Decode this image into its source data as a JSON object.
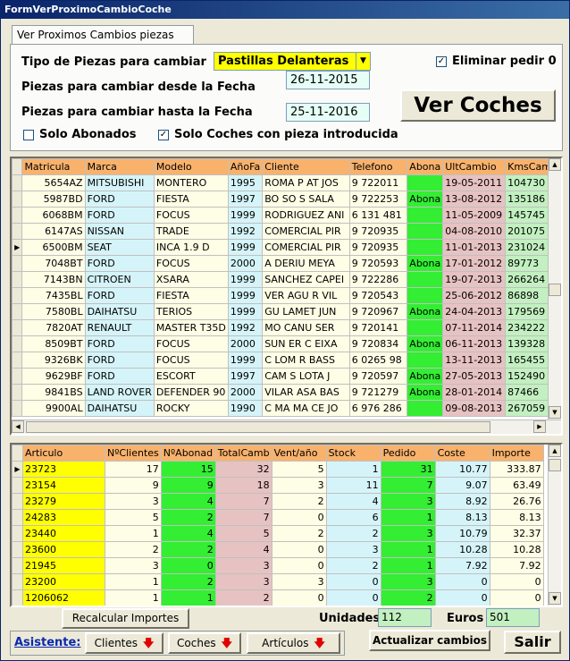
{
  "window": {
    "title": "FormVerProximoCambioCoche"
  },
  "tab": {
    "label": "Ver Proximos Cambios piezas"
  },
  "filters": {
    "tipo_label": "Tipo de Piezas para cambiar",
    "tipo_value": "Pastillas Delanteras",
    "desde_label": "Piezas para cambiar desde la Fecha",
    "desde_value": "26-11-2015",
    "hasta_label": "Piezas para cambiar hasta la Fecha",
    "hasta_value": "25-11-2016",
    "solo_abonados_label": "Solo Abonados",
    "solo_abonados_checked": false,
    "solo_coches_label": "Solo Coches con pieza introducida",
    "solo_coches_checked": true,
    "eliminar_label": "Eliminar pedir 0",
    "eliminar_checked": true,
    "ver_coches_label": "Ver Coches"
  },
  "cars": {
    "columns": [
      "Matricula",
      "Marca",
      "Modelo",
      "AñoFa",
      "Cliente",
      "Telefono",
      "Abona",
      "UltCambio",
      "KmsCamb"
    ],
    "current_row": 4,
    "rows": [
      [
        "5654AZ",
        "MITSUBISHI",
        "MONTERO",
        "1995",
        "ROMA P  AT JOS",
        "9   722011",
        "",
        "19-05-2011",
        "104730"
      ],
      [
        "5987BD",
        "FORD",
        "FIESTA",
        "1997",
        "BO  SO  S SALA",
        "9   722253",
        "Abona",
        "13-08-2012",
        "135186"
      ],
      [
        "6068BM",
        "FORD",
        "FOCUS",
        "1999",
        "RODRIGUEZ ANI",
        "6  131  481",
        "",
        "11-05-2009",
        "145745"
      ],
      [
        "6147AS",
        "NISSAN",
        "TRADE",
        "1992",
        "COMERCIAL PIR",
        "9   720935",
        "",
        "04-08-2010",
        "201075"
      ],
      [
        "6500BM",
        "SEAT",
        "INCA 1.9 D",
        "1999",
        "COMERCIAL PIR",
        "9   720935",
        "",
        "11-01-2013",
        "231024"
      ],
      [
        "7048BT",
        "FORD",
        "FOCUS",
        "2000",
        "A  DERIU MEYA",
        "9   720593",
        "Abona",
        "17-01-2012",
        "89773"
      ],
      [
        "7143BN",
        "CITROEN",
        "XSARA",
        "1999",
        "SANCHEZ CAPEI",
        "9   722286",
        "",
        "19-07-2013",
        "266264"
      ],
      [
        "7435BL",
        "FORD",
        "FIESTA",
        "1999",
        "VER  AGU  R VIL",
        "9   720543",
        "",
        "25-06-2012",
        "86898"
      ],
      [
        "7580BL",
        "DAIHATSU",
        "TERIOS",
        "1999",
        "GU  LAMET JUN",
        "9   720967",
        "Abona",
        "24-04-2013",
        "179569"
      ],
      [
        "7820AT",
        "RENAULT",
        "MASTER T35D",
        "1992",
        "MO  CANU   SER",
        "9   720141",
        "",
        "07-11-2014",
        "234222"
      ],
      [
        "8509BT",
        "FORD",
        "FOCUS",
        "2000",
        "SUN  ER C  EIXA",
        "9   720834",
        "Abona",
        "06-11-2013",
        "139328"
      ],
      [
        "9326BK",
        "FORD",
        "FOCUS",
        "1999",
        "C  LOM  R BASS",
        "6  0265  98",
        "",
        "13-11-2013",
        "165455"
      ],
      [
        "9629BF",
        "FORD",
        "ESCORT",
        "1997",
        "CAM  S   LOTA J",
        "9   720597",
        "Abona",
        "27-05-2013",
        "152490"
      ],
      [
        "9841BS",
        "LAND ROVER",
        "DEFENDER 90",
        "2000",
        "VILAR  ASA BAS",
        "9   721279",
        "Abona",
        "28-01-2014",
        "87466"
      ],
      [
        "9900AL",
        "DAIHATSU",
        "ROCKY",
        "1990",
        "C  MA MA  CE JO",
        "6  976  286",
        "",
        "09-08-2013",
        "267059"
      ]
    ]
  },
  "parts": {
    "columns": [
      "Articulo",
      "NºClientes",
      "NºAbonad",
      "TotalCamb",
      "Vent/año",
      "Stock",
      "Pedido",
      "Coste",
      "Importe"
    ],
    "current_row": 0,
    "rows": [
      [
        "23723",
        "17",
        "15",
        "32",
        "5",
        "1",
        "31",
        "10.77",
        "333.87"
      ],
      [
        "23154",
        "9",
        "9",
        "18",
        "3",
        "11",
        "7",
        "9.07",
        "63.49"
      ],
      [
        "23279",
        "3",
        "4",
        "7",
        "2",
        "4",
        "3",
        "8.92",
        "26.76"
      ],
      [
        "24283",
        "5",
        "2",
        "7",
        "0",
        "6",
        "1",
        "8.13",
        "8.13"
      ],
      [
        "23440",
        "1",
        "4",
        "5",
        "2",
        "2",
        "3",
        "10.79",
        "32.37"
      ],
      [
        "23600",
        "2",
        "2",
        "4",
        "0",
        "3",
        "1",
        "10.28",
        "10.28"
      ],
      [
        "21945",
        "3",
        "0",
        "3",
        "0",
        "2",
        "1",
        "7.92",
        "7.92"
      ],
      [
        "23200",
        "1",
        "2",
        "3",
        "3",
        "0",
        "3",
        "0",
        "0"
      ],
      [
        "1206062",
        "1",
        "1",
        "2",
        "0",
        "0",
        "2",
        "0",
        "0"
      ]
    ]
  },
  "footer": {
    "recalcular_label": "Recalcular Importes",
    "unidades_label": "Unidades",
    "unidades_value": "112",
    "euros_label": "Euros",
    "euros_value": "501",
    "asistente_label": "Asistente:",
    "clientes_label": "Clientes",
    "coches_label": "Coches",
    "articulos_label": "Artículos",
    "actualizar_label": "Actualizar cambios",
    "salir_label": "Salir"
  },
  "colors": {
    "header": "#f9b26c",
    "yellow": "#ffff00",
    "cream": "#fefde5",
    "cyan": "#d5f4f9",
    "green": "#33ee33",
    "pink": "#e7c2c2",
    "lightgreen": "#c2f0c0"
  }
}
